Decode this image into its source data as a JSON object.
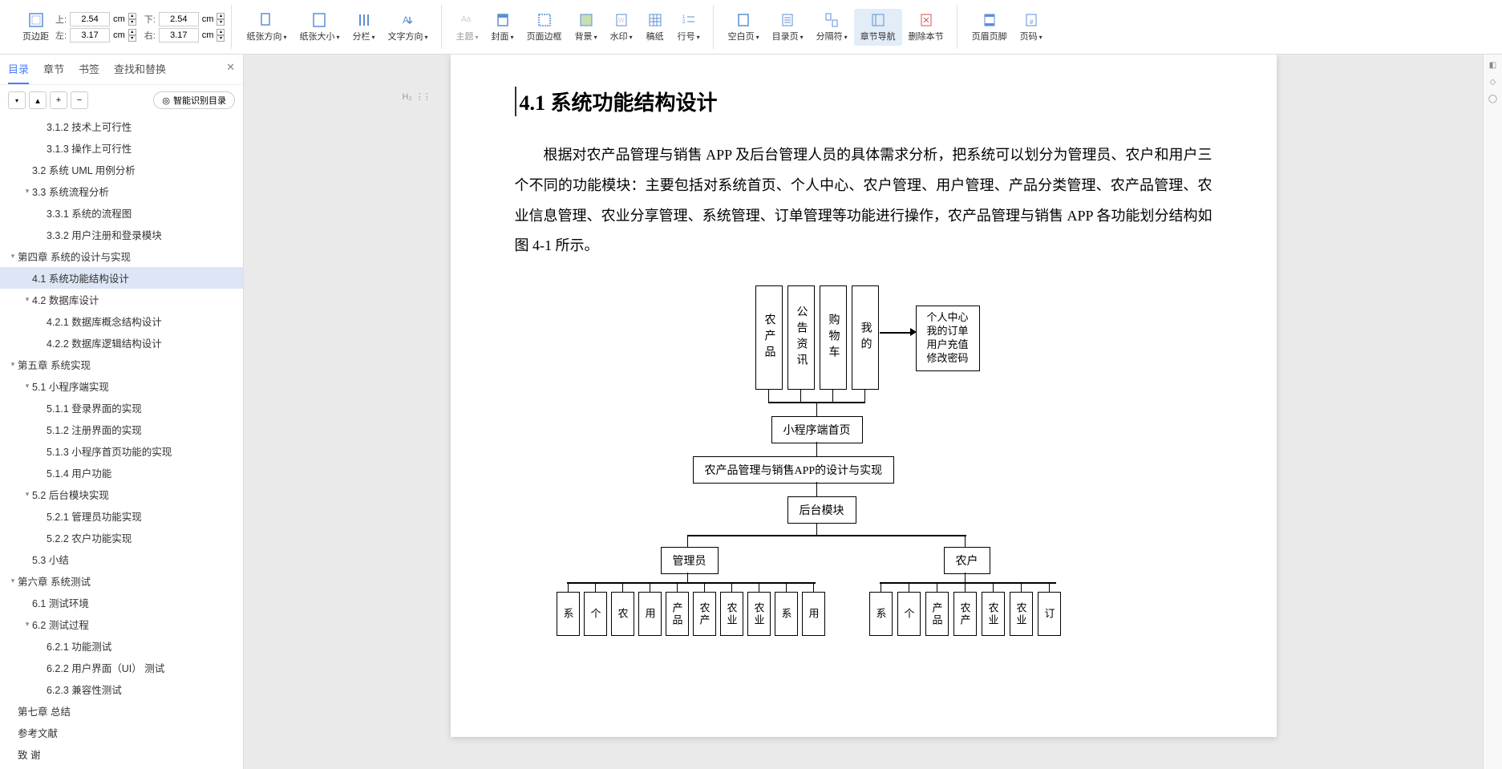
{
  "ribbon": {
    "margins": {
      "label": "页边距",
      "top_label": "上:",
      "top_value": "2.54",
      "top_unit": "cm",
      "bottom_label": "下:",
      "bottom_value": "2.54",
      "bottom_unit": "cm",
      "left_label": "左:",
      "left_value": "3.17",
      "left_unit": "cm",
      "right_label": "右:",
      "right_value": "3.17",
      "right_unit": "cm"
    },
    "buttons": {
      "orientation": "纸张方向",
      "paperSize": "纸张大小",
      "columns": "分栏",
      "textDirection": "文字方向",
      "theme": "主题",
      "cover": "封面",
      "pageBorder": "页面边框",
      "background": "背景",
      "watermark": "水印",
      "draft": "稿纸",
      "lineNumber": "行号",
      "blankPage": "空白页",
      "tocPage": "目录页",
      "separator": "分隔符",
      "chapterNav": "章节导航",
      "deleteSection": "删除本节",
      "headerFooter": "页眉页脚",
      "pageNumber": "页码"
    }
  },
  "sidebar": {
    "tabs": {
      "toc": "目录",
      "chapter": "章节",
      "bookmark": "书签",
      "findReplace": "查找和替换"
    },
    "smartToc": "智能识别目录",
    "items": [
      {
        "indent": 3,
        "label": "3.1.2 技术上可行性"
      },
      {
        "indent": 3,
        "label": "3.1.3 操作上可行性"
      },
      {
        "indent": 2,
        "label": "3.2  系统 UML 用例分析"
      },
      {
        "indent": 2,
        "label": "3.3  系统流程分析",
        "caret": true
      },
      {
        "indent": 3,
        "label": "3.3.1 系统的流程图"
      },
      {
        "indent": 3,
        "label": "3.3.2 用户注册和登录模块"
      },
      {
        "indent": 1,
        "label": "第四章  系统的设计与实现",
        "caret": true
      },
      {
        "indent": 2,
        "label": "4.1  系统功能结构设计",
        "active": true
      },
      {
        "indent": 2,
        "label": "4.2  数据库设计",
        "caret": true
      },
      {
        "indent": 3,
        "label": "4.2.1 数据库概念结构设计"
      },
      {
        "indent": 3,
        "label": "4.2.2 数据库逻辑结构设计"
      },
      {
        "indent": 1,
        "label": "第五章  系统实现",
        "caret": true
      },
      {
        "indent": 2,
        "label": "5.1  小程序端实现",
        "caret": true
      },
      {
        "indent": 3,
        "label": "5.1.1 登录界面的实现"
      },
      {
        "indent": 3,
        "label": "5.1.2 注册界面的实现"
      },
      {
        "indent": 3,
        "label": "5.1.3 小程序首页功能的实现"
      },
      {
        "indent": 3,
        "label": "5.1.4 用户功能"
      },
      {
        "indent": 2,
        "label": "5.2 后台模块实现",
        "caret": true
      },
      {
        "indent": 3,
        "label": "5.2.1 管理员功能实现"
      },
      {
        "indent": 3,
        "label": "5.2.2 农户功能实现"
      },
      {
        "indent": 2,
        "label": "5.3 小结"
      },
      {
        "indent": 1,
        "label": "第六章  系统测试",
        "caret": true
      },
      {
        "indent": 2,
        "label": "6.1  测试环境"
      },
      {
        "indent": 2,
        "label": "6.2  测试过程",
        "caret": true
      },
      {
        "indent": 3,
        "label": "6.2.1 功能测试"
      },
      {
        "indent": 3,
        "label": "6.2.2 用户界面（UI）  测试"
      },
      {
        "indent": 3,
        "label": "6.2.3 兼容性测试"
      },
      {
        "indent": 1,
        "label": "第七章 总结"
      },
      {
        "indent": 1,
        "label": "参考文献"
      },
      {
        "indent": 1,
        "label": "致 谢"
      }
    ]
  },
  "document": {
    "headingMarker": "H₂",
    "heading": "4.1 系统功能结构设计",
    "paragraph": "根据对农产品管理与销售 APP 及后台管理人员的具体需求分析，把系统可以划分为管理员、农户和用户三个不同的功能模块：主要包括对系统首页、个人中心、农户管理、用户管理、产品分类管理、农产品管理、农业信息管理、农业分享管理、系统管理、订单管理等功能进行操作，农产品管理与销售 APP 各功能划分结构如图 4-1 所示。",
    "diagram": {
      "topBoxes": [
        "农产品",
        "公告资讯",
        "购物车",
        "我的"
      ],
      "sideBox": "个人中心\n我的订单\n用户充值\n修改密码",
      "miniHome": "小程序端首页",
      "mainTitle": "农产品管理与销售APP的设计与实现",
      "backend": "后台模块",
      "admin": "管理员",
      "farmer": "农户",
      "bottom1": [
        "系",
        "个",
        "农",
        "用",
        "产品",
        "农产",
        "农业",
        "农业",
        "系",
        "用"
      ],
      "bottom2": [
        "系",
        "个",
        "产品",
        "农产",
        "农业",
        "农业",
        "订"
      ]
    }
  }
}
